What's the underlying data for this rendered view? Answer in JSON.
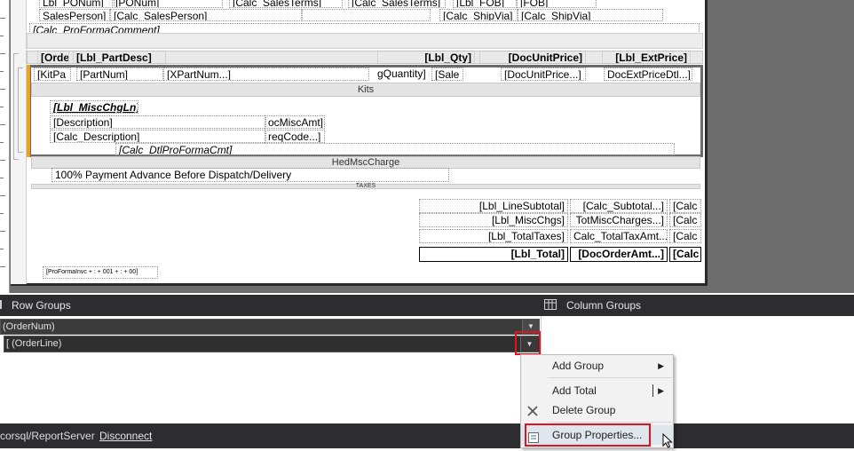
{
  "report": {
    "top_rows": [
      [
        "Lbl_PONum]",
        "[PONum]",
        "[Calc_SalesTerms]",
        "[Calc_SalesTerms]",
        "[Lbl_FOB]",
        "[FOB]"
      ],
      [
        "SalesPerson]",
        "[Calc_SalesPerson]",
        "[Calc_ShipVia]",
        "[Calc_ShipVia]"
      ]
    ],
    "comment": "[Calc_ProFormaComment]",
    "header_cells": [
      "[Orde",
      "[Lbl_PartDesc]",
      "[Lbl_Qty]",
      "[DocUnitPrice]",
      "[Lbl_ExtPrice]"
    ],
    "detail_cells": [
      "[KitPa",
      "[PartNum]",
      "[XPartNum...]",
      "gQuantity]",
      "[Sale",
      "[DocUnitPrice...]",
      "DocExtPriceDtl...]"
    ],
    "kits_band": "Kits",
    "misc": {
      "label": "[Lbl_MiscChgLn]",
      "description_label": "[Description]",
      "misc_amt": "ocMiscAmt]",
      "calc_description": "[Calc_Description]",
      "req_code": "reqCode...]",
      "dtl_comment": "[Calc_DtlProFormaCmt]"
    },
    "hed_misc_band": "HedMscCharge",
    "payment_note": "100% Payment Advance Before Dispatch/Delivery",
    "taxes_band": "TAXES",
    "totals": [
      {
        "label": "[Lbl_LineSubtotal]",
        "value": "[Calc_Subtotal...]",
        "extra": "[Calc"
      },
      {
        "label": "[Lbl_MiscChgs]",
        "value": "TotMiscCharges...]",
        "extra": "[Calc"
      },
      {
        "label": "[Lbl_TotalTaxes]",
        "value": "Calc_TotalTaxAmt...]",
        "extra": "[Calc"
      }
    ],
    "grand_total": {
      "label": "[Lbl_Total]",
      "value": "[DocOrderAmt...]",
      "extra": "[Calc"
    },
    "footer": "[ProFormaInvc + : + 001 + : + 00]"
  },
  "panels": {
    "row_groups_title": "Row Groups",
    "column_groups_title": "Column Groups",
    "row_groups": [
      "(OrderNum)",
      "[ (OrderLine)"
    ]
  },
  "context_menu": {
    "items": [
      "Add Group",
      "Add Total",
      "Delete Group",
      "Group Properties..."
    ]
  },
  "status": {
    "server": "corsql/ReportServer",
    "disconnect": "Disconnect"
  },
  "colors": {
    "accent_highlight": "#e0141e",
    "selection_bar": "#f0a020"
  }
}
